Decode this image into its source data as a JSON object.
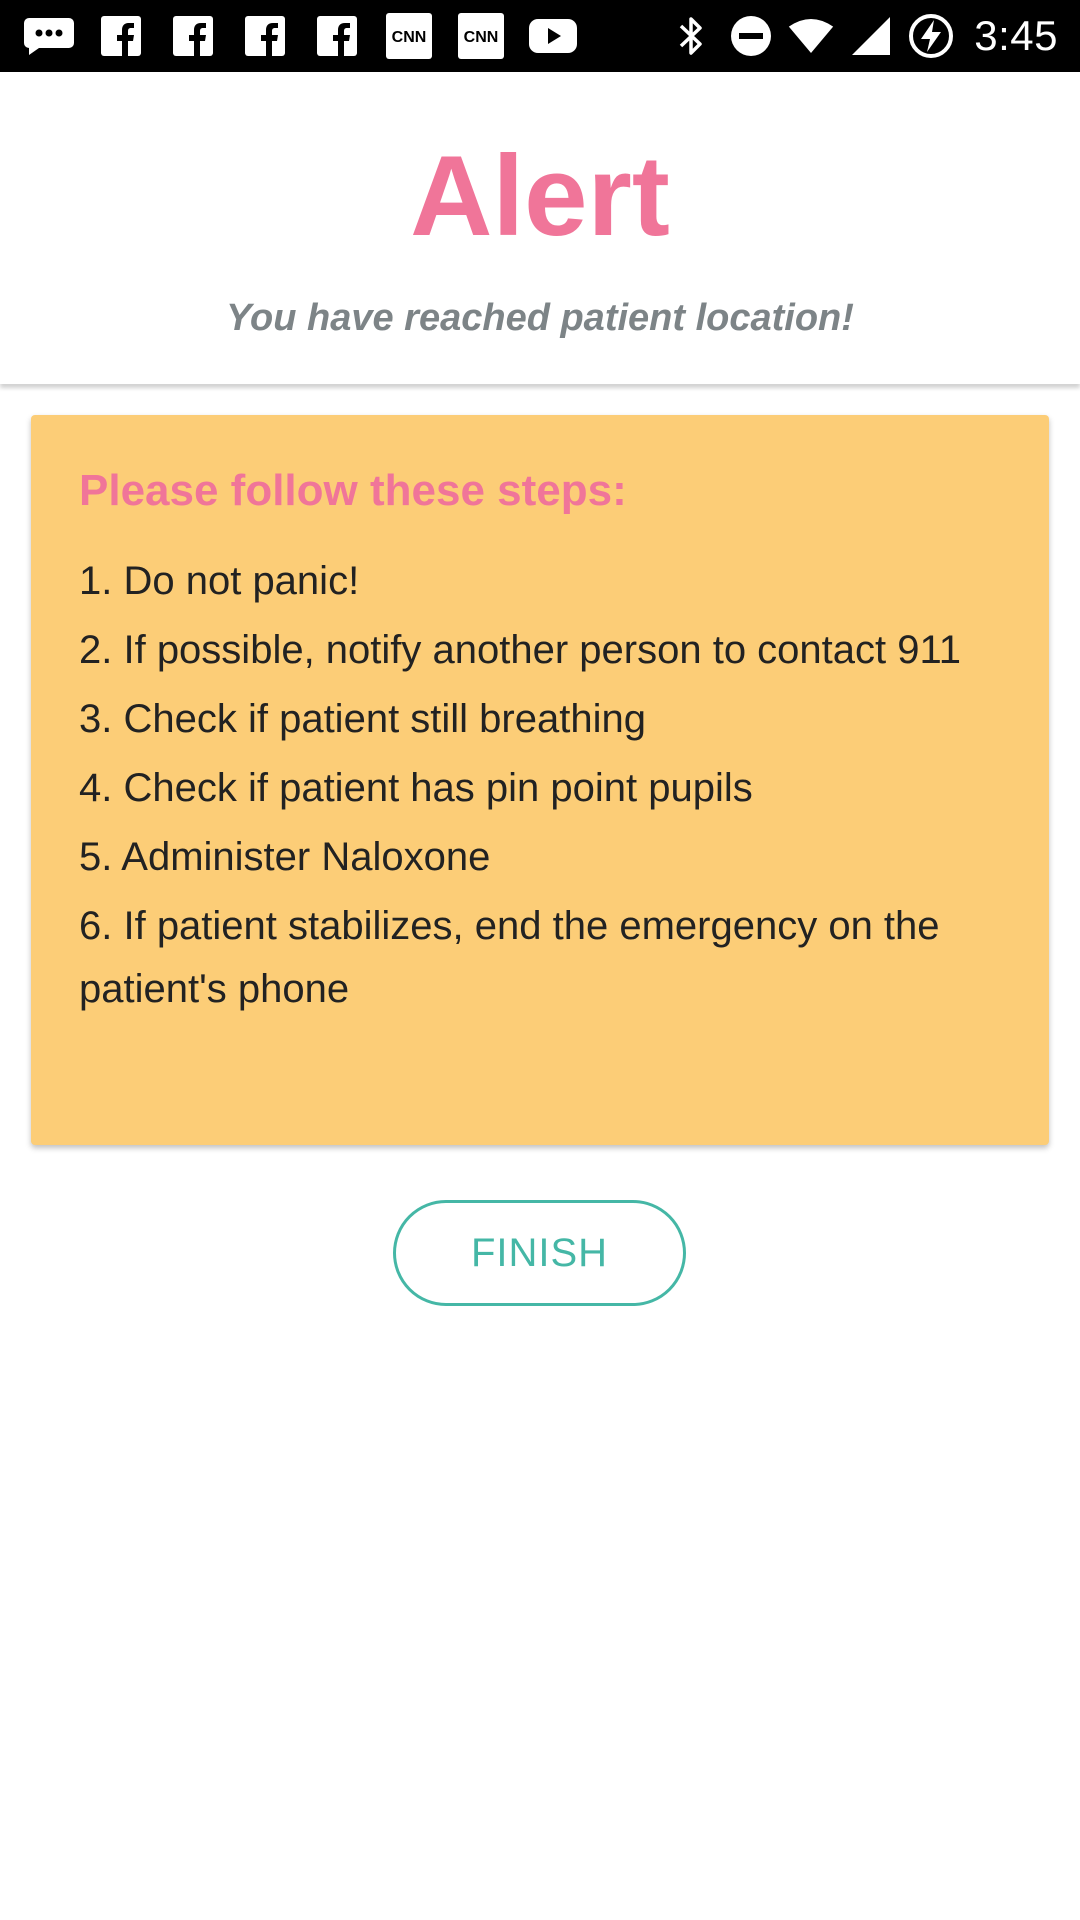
{
  "status_bar": {
    "time": "3:45",
    "left_icons": [
      "chat-bubble-icon",
      "facebook-icon",
      "facebook-icon",
      "facebook-icon",
      "facebook-icon",
      "cnn-icon",
      "cnn-icon",
      "youtube-icon"
    ],
    "right_icons": [
      "bluetooth-icon",
      "do-not-disturb-icon",
      "wifi-icon",
      "cell-signal-icon",
      "battery-charging-icon"
    ],
    "cnn_text": "CNN"
  },
  "header": {
    "title": "Alert",
    "subtitle": "You have reached patient location!"
  },
  "card": {
    "heading": "Please follow these steps:",
    "steps": [
      "1. Do not panic!",
      "2. If possible, notify another person to contact 911",
      "3. Check if patient still breathing",
      "4. Check if patient has pin point pupils",
      "5. Administer Naloxone",
      "6. If patient stabilizes, end the emergency on the patient's phone"
    ]
  },
  "actions": {
    "finish_label": "FINISH"
  },
  "colors": {
    "accent_pink": "#f07599",
    "card_background": "#fccd77",
    "button_teal": "#45b7a6",
    "subtitle_gray": "#7d8487"
  }
}
